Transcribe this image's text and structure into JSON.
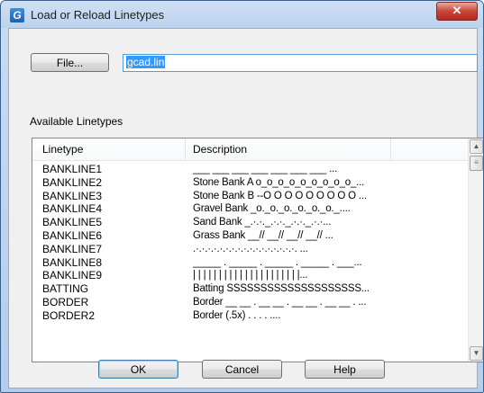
{
  "window": {
    "title": "Load or Reload Linetypes",
    "app_icon": "G",
    "close_glyph": "✕"
  },
  "file_button": "File...",
  "file_input_value": "gcad.lin",
  "available_label": "Available Linetypes",
  "columns": [
    "Linetype",
    "Description"
  ],
  "rows": [
    {
      "linetype": "BANKLINE1",
      "description": "___ ___ ___ ___ ___ ___ ___ ..."
    },
    {
      "linetype": "BANKLINE2",
      "description": "Stone Bank A o_o_o_o_o_o_o_o_o_..."
    },
    {
      "linetype": "BANKLINE3",
      "description": "Stone Bank B --O O O O O O O O O ..."
    },
    {
      "linetype": "BANKLINE4",
      "description": "Gravel Bank _o._o._o._o._o._o._...."
    },
    {
      "linetype": "BANKLINE5",
      "description": "Sand Bank _.·.·._.·.·._.·.·._.·.·..."
    },
    {
      "linetype": "BANKLINE6",
      "description": "Grass Bank __// __// __// __// ..."
    },
    {
      "linetype": "BANKLINE7",
      "description": ".·.·.·.·.·.·.·.·.·.·.·.·.·.·.·.·.·. ..."
    },
    {
      "linetype": "BANKLINE8",
      "description": "_____ . _____ . _____ . _____ . ___..."
    },
    {
      "linetype": "BANKLINE9",
      "description": "| | | | | | | | | | | | | | | | | | | | |..."
    },
    {
      "linetype": "BATTING",
      "description": "Batting SSSSSSSSSSSSSSSSSSSS..."
    },
    {
      "linetype": "BORDER",
      "description": "Border __ __ . __ __ . __ __ . __ __ . ..."
    },
    {
      "linetype": "BORDER2",
      "description": "Border (.5x) . . . . ...."
    }
  ],
  "buttons": {
    "ok": "OK",
    "cancel": "Cancel",
    "help": "Help"
  }
}
